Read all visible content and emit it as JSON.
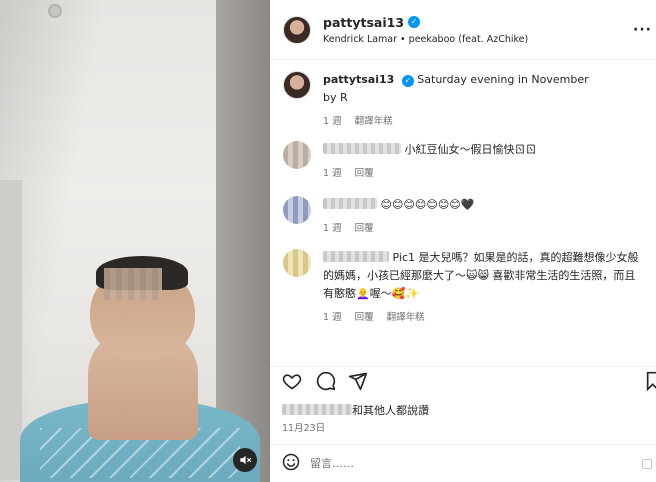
{
  "post": {
    "author": "pattytsai13",
    "audio": "Kendrick Lamar • peekaboo (feat. AzChike)"
  },
  "caption": {
    "author": "pattytsai13",
    "text": "Saturday evening in November",
    "byline": "by R",
    "time": "1 週",
    "translate": "翻譯年糕"
  },
  "comments": [
    {
      "text": "小紅豆仙女～假日愉快ㄖㄖ",
      "time": "1 週",
      "reply": "回覆"
    },
    {
      "text": "😊😊😊😊😊😊😊🖤",
      "time": "1 週",
      "reply": "回覆"
    },
    {
      "text": "Pic1 是大兒嗎？如果是的話，真的超難想像少女般的媽媽，小孩已經那麼大了～🙀😸 喜歡非常生活的生活照，而且有憨憨👩‍🦲喔～🥰✨",
      "time": "1 週",
      "reply": "回覆",
      "translate": "翻譯年糕"
    }
  ],
  "likes_text": "和其他人都說讚",
  "date": "11月23日",
  "comment_placeholder": "留言……",
  "icons": {
    "like": "heart-icon",
    "comment": "comment-icon",
    "share": "send-icon",
    "save": "bookmark-icon",
    "emoji": "emoji-icon",
    "mute": "muted-speaker-icon",
    "more": "more-icon"
  },
  "colors": {
    "verified": "#0095f6",
    "muted_text": "#737373",
    "text": "#262626"
  }
}
